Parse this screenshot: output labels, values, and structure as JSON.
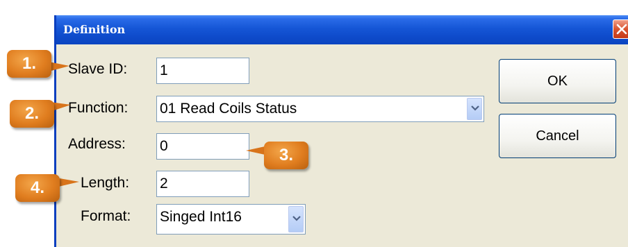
{
  "dialog": {
    "title": "Definition",
    "close_icon": "close-icon"
  },
  "form": {
    "slave_id": {
      "label": "Slave ID:",
      "value": "1"
    },
    "function": {
      "label": "Function:",
      "value": "01 Read Coils Status"
    },
    "address": {
      "label": "Address:",
      "value": "0"
    },
    "length": {
      "label": "Length:",
      "value": "2"
    },
    "format": {
      "label": "Format:",
      "value": "Singed Int16"
    }
  },
  "buttons": {
    "ok": "OK",
    "cancel": "Cancel"
  },
  "callouts": [
    "1.",
    "2.",
    "3.",
    "4."
  ],
  "colors": {
    "titlebar": "#0f4ccc",
    "dialog_bg": "#ece9d8",
    "callout": "#e07d1f",
    "close_button": "#d9542f"
  },
  "icons": {
    "dropdown": "chevron-down-icon"
  }
}
